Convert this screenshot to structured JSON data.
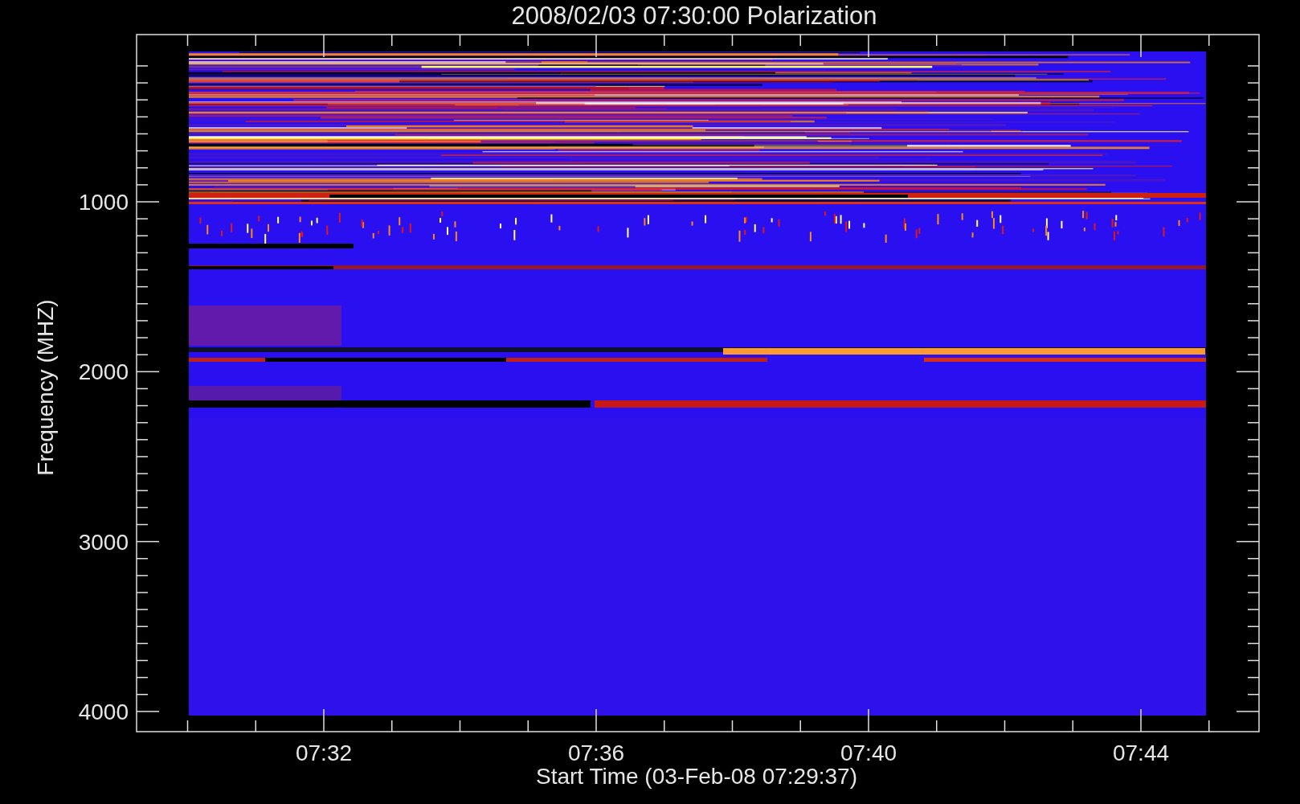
{
  "title": "2008/02/03 07:30:00 Polarization",
  "ylabel": "Frequency (MHZ)",
  "xlabel": "Start Time (03-Feb-08 07:29:37)",
  "yticks": [
    "1000",
    "2000",
    "3000",
    "4000"
  ],
  "xticks": [
    "07:32",
    "07:36",
    "07:40",
    "07:44"
  ]
}
